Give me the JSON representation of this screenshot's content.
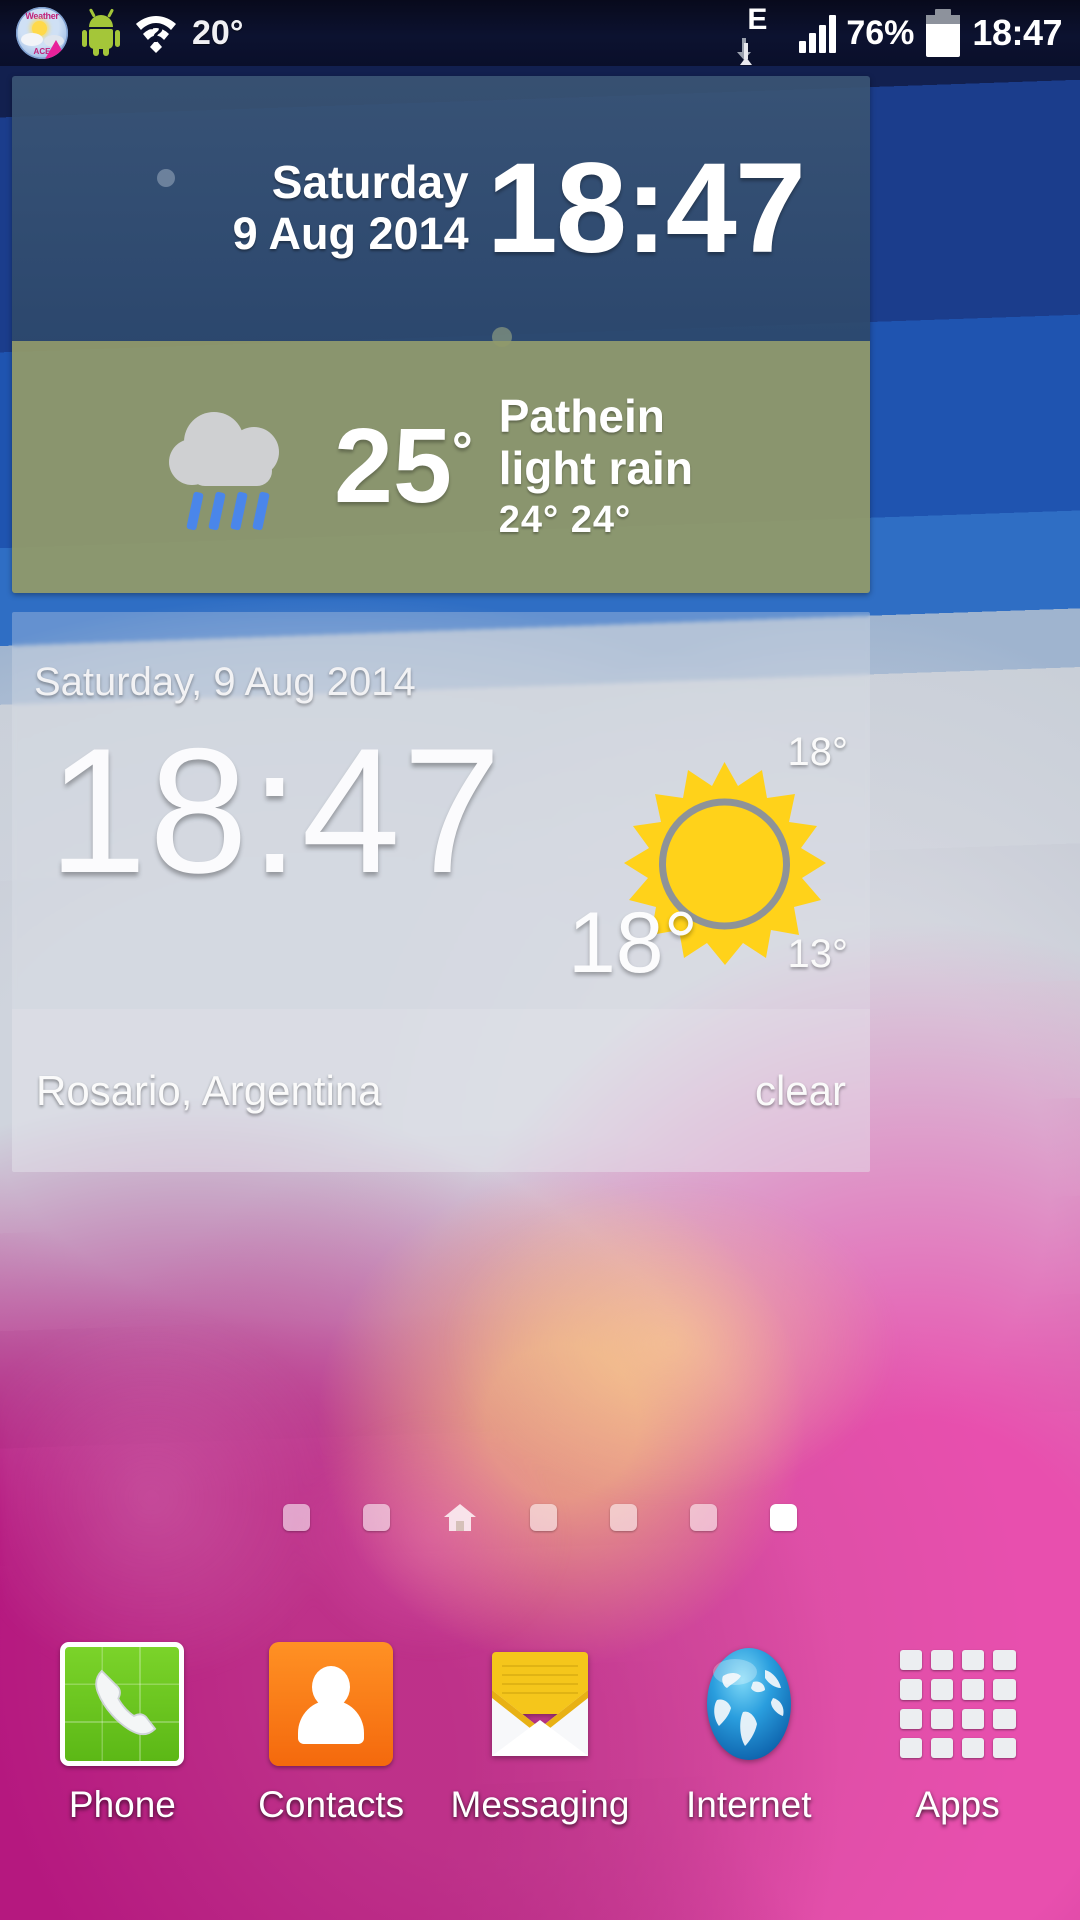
{
  "statusbar": {
    "weather_app_icon": "weather-ace-icon",
    "weather_app_label_top": "Weather",
    "weather_app_label_bottom": "ACE",
    "android_icon": "android-robot-icon",
    "wifi_icon": "wifi-question-icon",
    "ambient_temperature": "20°",
    "network_type": "E",
    "data_transfer_icon": "data-up-down-arrows-icon",
    "signal_icon": "signal-bars-icon",
    "battery_percent": "76%",
    "battery_icon": "battery-icon",
    "clock": "18:47"
  },
  "widget_clock_weather": {
    "day": "Saturday",
    "date": "9 Aug 2014",
    "time": "18:47",
    "weather_icon": "rain-cloud-icon",
    "temperature": "25",
    "degree": "°",
    "city": "Pathein",
    "condition": "light rain",
    "high_low": "24°  24°"
  },
  "widget_big_clock": {
    "date": "Saturday, 9 Aug 2014",
    "time": "18:47",
    "weather_icon": "sun-icon",
    "high": "18°",
    "low": "13°",
    "current": "18°",
    "location": "Rosario, Argentina",
    "condition": "clear"
  },
  "page_indicator": {
    "count": 7,
    "home_index": 2,
    "active_index": 6
  },
  "dock": {
    "items": [
      {
        "label": "Phone",
        "icon": "phone-icon"
      },
      {
        "label": "Contacts",
        "icon": "contacts-icon"
      },
      {
        "label": "Messaging",
        "icon": "envelope-icon"
      },
      {
        "label": "Internet",
        "icon": "globe-icon"
      },
      {
        "label": "Apps",
        "icon": "apps-grid-icon"
      }
    ]
  },
  "colors": {
    "widget1_clock_bg": "#3a5474",
    "widget1_weather_bg": "#929a68",
    "sun_yellow": "#ffd21a",
    "phone_green": "#6bc71e",
    "contacts_orange": "#f77f14",
    "envelope_yellow": "#f5c61b",
    "globe_blue": "#1b8fd6"
  }
}
